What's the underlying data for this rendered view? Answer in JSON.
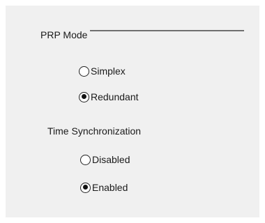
{
  "prp_mode": {
    "title": "PRP Mode",
    "options": [
      {
        "label": "Simplex",
        "checked": false
      },
      {
        "label": "Redundant",
        "checked": true
      }
    ]
  },
  "time_sync": {
    "title": "Time Synchronization",
    "options": [
      {
        "label": "Disabled",
        "checked": false
      },
      {
        "label": "Enabled",
        "checked": true
      }
    ]
  }
}
